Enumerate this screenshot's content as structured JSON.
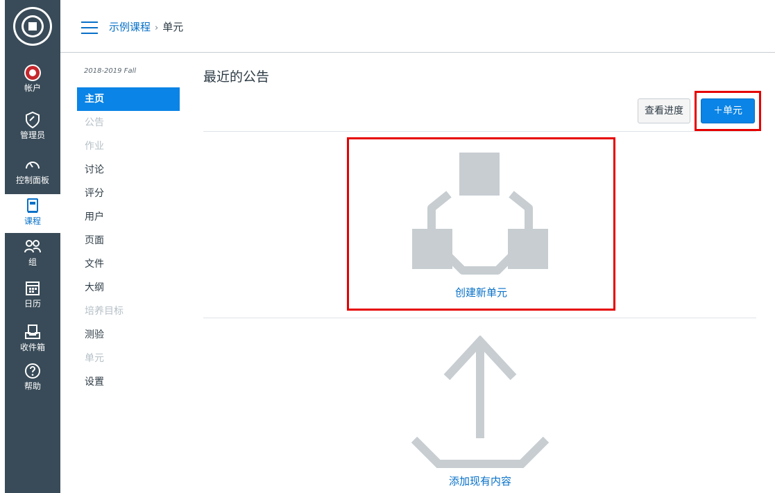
{
  "header": {
    "breadcrumb": [
      "示例课程",
      "单元"
    ],
    "separator": "›"
  },
  "global_nav": [
    {
      "label": "帐户",
      "icon": "account-icon"
    },
    {
      "label": "管理员",
      "icon": "admin-shield-icon"
    },
    {
      "label": "控制面板",
      "icon": "dashboard-gauge-icon"
    },
    {
      "label": "课程",
      "icon": "courses-book-icon",
      "active": true
    },
    {
      "label": "组",
      "icon": "groups-icon"
    },
    {
      "label": "日历",
      "icon": "calendar-icon"
    },
    {
      "label": "收件箱",
      "icon": "inbox-icon"
    },
    {
      "label": "帮助",
      "icon": "help-icon"
    }
  ],
  "course_nav": {
    "term": "2018-2019 Fall",
    "items": [
      {
        "label": "主页",
        "state": "active"
      },
      {
        "label": "公告",
        "state": "disabled"
      },
      {
        "label": "作业",
        "state": "disabled"
      },
      {
        "label": "讨论",
        "state": "normal"
      },
      {
        "label": "评分",
        "state": "normal"
      },
      {
        "label": "用户",
        "state": "normal"
      },
      {
        "label": "页面",
        "state": "normal"
      },
      {
        "label": "文件",
        "state": "normal"
      },
      {
        "label": "大纲",
        "state": "normal"
      },
      {
        "label": "培养目标",
        "state": "disabled"
      },
      {
        "label": "测验",
        "state": "normal"
      },
      {
        "label": "单元",
        "state": "disabled"
      },
      {
        "label": "设置",
        "state": "normal"
      }
    ]
  },
  "main": {
    "title": "最近的公告",
    "view_progress_label": "查看进度",
    "add_module_label": "＋单元",
    "create_module_label": "创建新单元",
    "add_existing_label": "添加现有内容"
  },
  "colors": {
    "nav_bg": "#394b58",
    "accent": "#0a84e6",
    "highlight": "#e60000",
    "illustration": "#c7cdd1"
  }
}
